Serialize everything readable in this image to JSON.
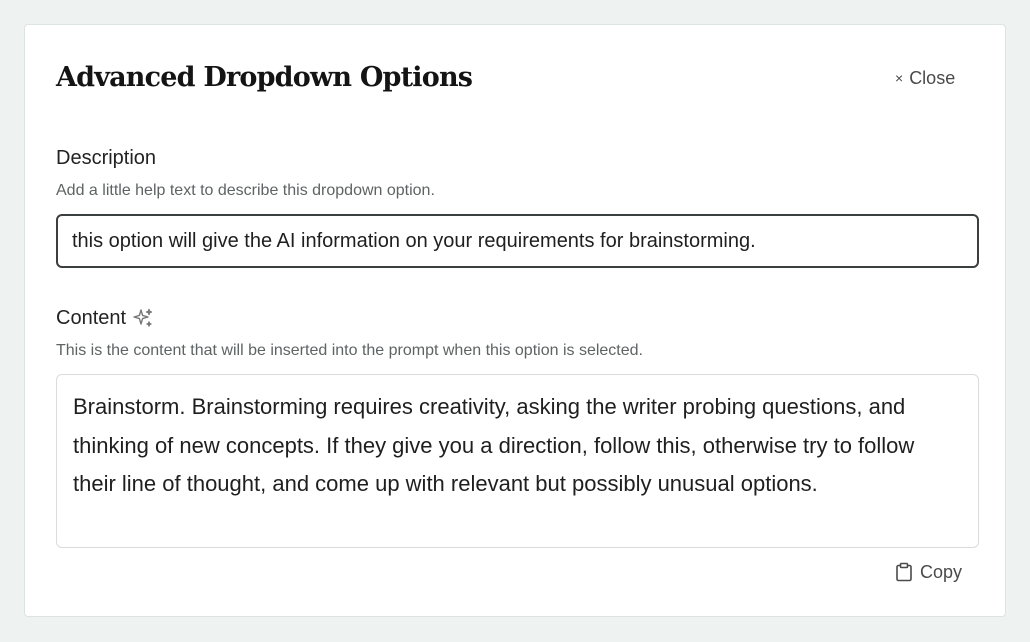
{
  "dialog": {
    "title": "Advanced Dropdown Options",
    "close_label": "Close",
    "close_icon": "×"
  },
  "description": {
    "label": "Description",
    "help": "Add a little help text to describe this dropdown option.",
    "value": "this option will give the AI information on your requirements for brainstorming."
  },
  "content": {
    "label": "Content",
    "help": "This is the content that will be inserted into the prompt when this option is selected.",
    "value": "Brainstorm. Brainstorming requires creativity, asking the writer probing questions, and thinking of new concepts. If they give you a direction, follow this, otherwise try to follow their line of thought, and come up with relevant but possibly unusual options.",
    "label_icon": "sparkle-icon"
  },
  "actions": {
    "copy_label": "Copy",
    "copy_icon": "clipboard-icon"
  }
}
